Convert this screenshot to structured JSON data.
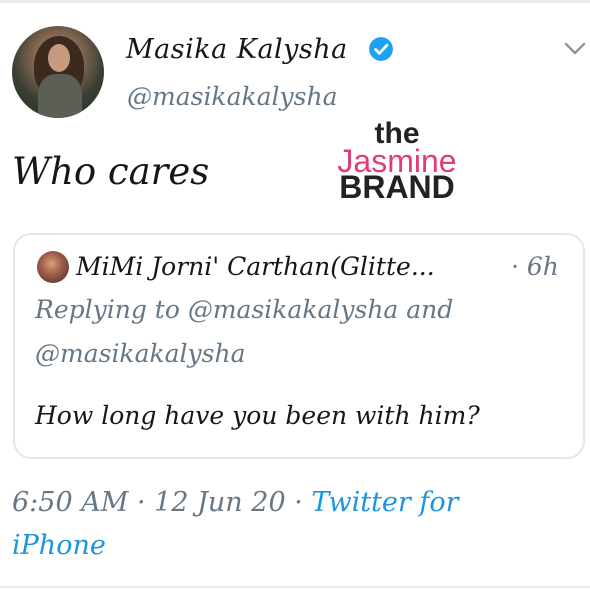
{
  "tweet": {
    "author_name": "Masika Kalysha",
    "author_handle": "@masikakalysha",
    "text": "Who cares",
    "verified": true,
    "timestamp": "6:50 AM",
    "separator": "·",
    "date": "12 Jun 20",
    "source_line1": "Twitter for",
    "source_line2": "iPhone"
  },
  "quoted": {
    "author_name": "MiMi Jorni' Carthan(Glitte...",
    "time": "· 6h",
    "reply_line1": "Replying to @masikakalysha and",
    "reply_line2": "@masikakalysha",
    "text": "How long have you been with him?"
  },
  "watermark": {
    "line1": "the",
    "line2": "Jasmine",
    "line3": "BRAND"
  },
  "colors": {
    "link": "#1b95e0",
    "secondary": "#657786",
    "verified": "#1da1f2",
    "watermark_pink": "#e23c72"
  },
  "icons": {
    "verified": "verified-badge-icon",
    "caret": "chevron-down-icon"
  }
}
